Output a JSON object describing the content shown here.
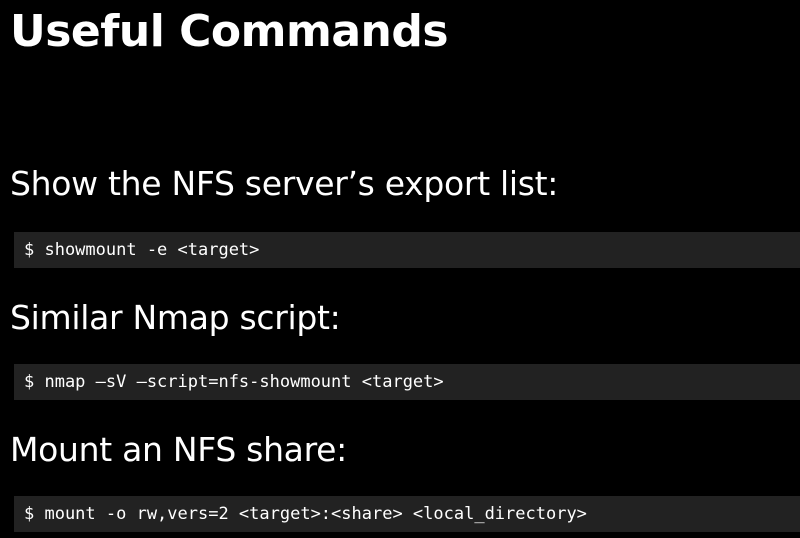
{
  "slide": {
    "title": "Useful Commands"
  },
  "sections": [
    {
      "heading": "Show the NFS server’s export list:",
      "command": "$ showmount -e <target>"
    },
    {
      "heading": "Similar Nmap script:",
      "command": "$ nmap –sV –script=nfs-showmount <target>"
    },
    {
      "heading": "Mount an NFS share:",
      "command": "$ mount -o rw,vers=2 <target>:<share> <local_directory>"
    }
  ],
  "colors": {
    "background": "#000000",
    "text": "#ffffff",
    "code_background": "#222222"
  }
}
